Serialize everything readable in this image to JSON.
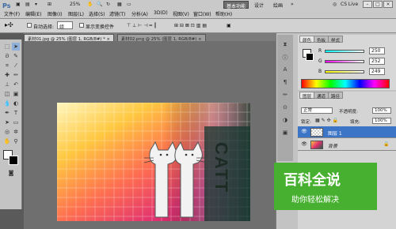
{
  "app": {
    "logo": "Ps",
    "menu": [
      "文件(F)",
      "编辑(E)",
      "图像(I)",
      "图层(L)",
      "选择(S)",
      "滤镜(T)",
      "分析(A)",
      "3D(D)",
      "视图(V)",
      "窗口(W)",
      "帮助(H)"
    ],
    "zoom": "25%",
    "workspaces": [
      "基本功能",
      "设计",
      "绘画"
    ],
    "more": "»",
    "cs_live": "CS Live",
    "window_buttons": [
      "–",
      "□",
      "×"
    ]
  },
  "options": {
    "auto_select_label": "自动选择:",
    "auto_select_value": "组",
    "show_transform_label": "显示变换控件"
  },
  "tabs": [
    {
      "label": "素材01.jpg @ 25% (图层 1, RGB/8#) *",
      "close": "×"
    },
    {
      "label": "素材02.png @ 25% (图层 1, RGB/8#)",
      "close": "×"
    }
  ],
  "color_panel": {
    "tabs": [
      "颜色",
      "色板",
      "样式"
    ],
    "R": {
      "label": "R",
      "value": "250"
    },
    "G": {
      "label": "G",
      "value": "252"
    },
    "B": {
      "label": "B",
      "value": "249"
    }
  },
  "layers_panel": {
    "tabs": [
      "图层",
      "通道",
      "路径"
    ],
    "blend_mode": "正常",
    "opacity_label": "不透明度:",
    "opacity_value": "100%",
    "lock_label": "锁定:",
    "fill_label": "填充:",
    "fill_value": "100%",
    "layers": [
      {
        "name": "图层 1",
        "selected": true
      },
      {
        "name": "背景",
        "selected": false
      }
    ]
  },
  "artwork": {
    "text": "CATT"
  },
  "watermark": {
    "title": "百科全说",
    "subtitle": "助你轻松解决"
  },
  "colors": {
    "accent": "#3c74c6",
    "watermark": "#48b030"
  }
}
